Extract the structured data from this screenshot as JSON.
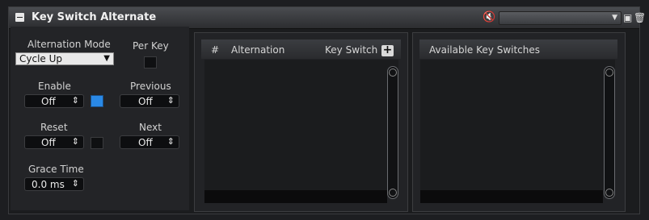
{
  "header": {
    "title": "Key Switch Alternate",
    "icons": [
      "collapse-icon",
      "speaker-muted-icon",
      "save-icon",
      "trash-icon"
    ]
  },
  "left": {
    "alternation_mode_label": "Alternation Mode",
    "alternation_mode_value": "Cycle Up",
    "per_key_label": "Per Key",
    "enable_label": "Enable",
    "enable_value": "Off",
    "previous_label": "Previous",
    "previous_value": "Off",
    "reset_label": "Reset",
    "reset_value": "Off",
    "next_label": "Next",
    "next_value": "Off",
    "grace_label": "Grace Time",
    "grace_value": "0.0 ms"
  },
  "alternation": {
    "col_num": "#",
    "col_alternation": "Alternation",
    "col_keyswitch": "Key Switch",
    "add_symbol": "+"
  },
  "available": {
    "header": "Available Key Switches"
  },
  "colors": {
    "accent_led": "#2a89e6",
    "background": "#1d1e21"
  }
}
